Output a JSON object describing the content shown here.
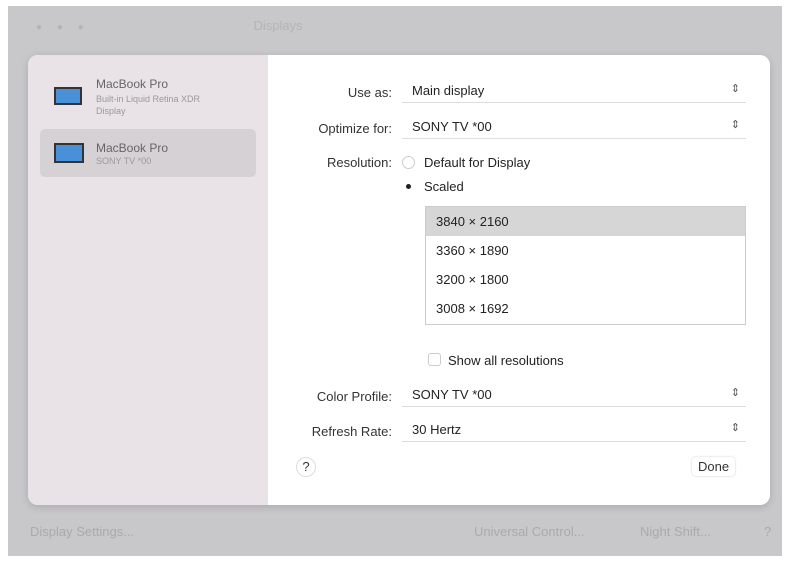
{
  "window": {
    "title": "Displays"
  },
  "sidebar": {
    "devices": [
      {
        "name": "MacBook Pro",
        "subtitle": "Built-in Liquid Retina XDR Display",
        "selected": false
      },
      {
        "name": "MacBook Pro",
        "subtitle": "SONY TV  *00",
        "selected": true
      }
    ]
  },
  "settings": {
    "use_as": {
      "label": "Use as:",
      "value": "Main display"
    },
    "optimize_for": {
      "label": "Optimize for:",
      "value": "SONY TV  *00"
    },
    "resolution": {
      "label": "Resolution:",
      "options": [
        "Default for Display",
        "Scaled"
      ],
      "selected": "Scaled"
    },
    "scaled_list": [
      "3840 × 2160",
      "3360 × 1890",
      "3200 × 1800",
      "3008 × 1692"
    ],
    "scaled_selected": "3840 × 2160",
    "show_all": {
      "label": "Show all resolutions",
      "checked": false
    },
    "color_profile": {
      "label": "Color Profile:",
      "value": "SONY TV  *00"
    },
    "refresh_rate": {
      "label": "Refresh Rate:",
      "value": "30 Hertz"
    },
    "help": "?",
    "done": "Done"
  },
  "footer": {
    "display_settings": "Display Settings...",
    "universal_control": "Universal Control...",
    "night_shift": "Night Shift...",
    "help": "?"
  }
}
